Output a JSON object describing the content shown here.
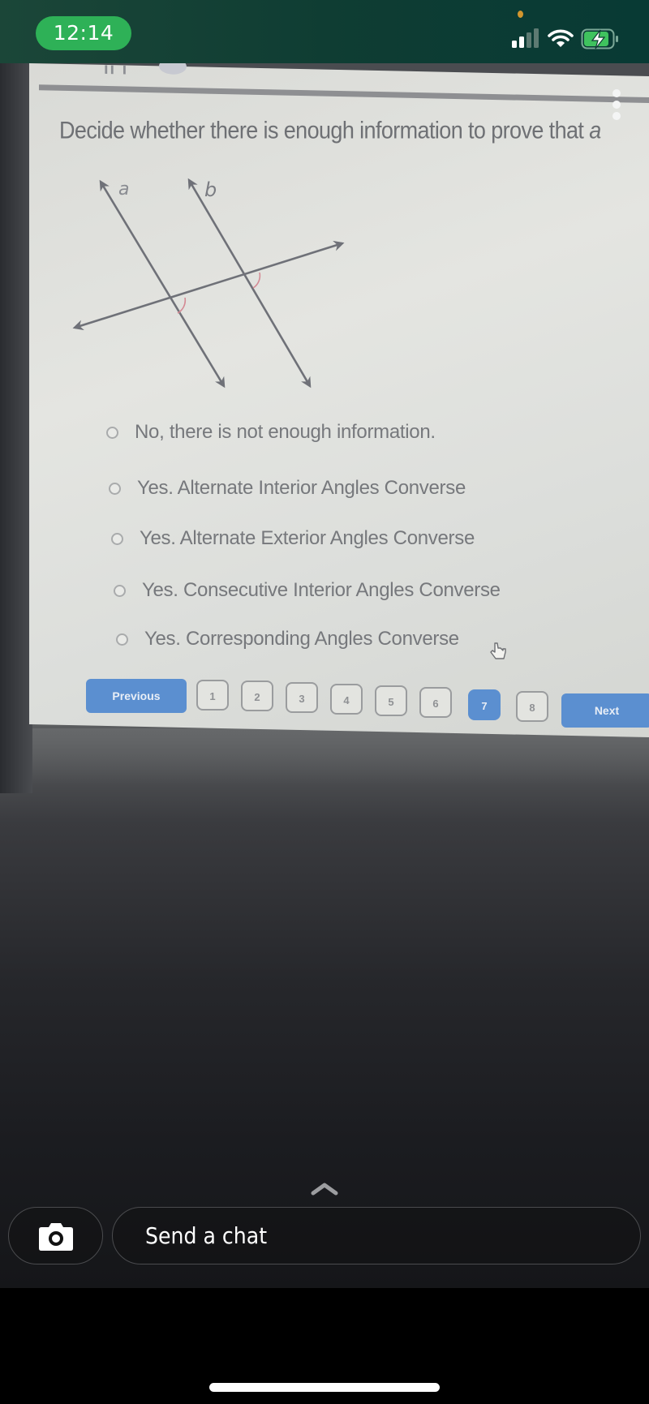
{
  "status_bar": {
    "time": "12:14",
    "icons": [
      "signal-icon",
      "wifi-icon",
      "battery-charging-icon"
    ],
    "time_pill_color": "#2eb157",
    "privacy_dot_color": "#d2962e"
  },
  "quiz": {
    "question": "Decide whether there is enough information to prove that",
    "question_trailing_italic": "a",
    "diagram": {
      "line_labels": [
        "a",
        "b"
      ],
      "description": "Two lines a and b cut by a transversal; two angles are marked with red arcs"
    },
    "options": [
      {
        "label": "No, there is not enough information.",
        "selected": false
      },
      {
        "label": "Yes. Alternate Interior Angles Converse",
        "selected": false
      },
      {
        "label": "Yes. Alternate Exterior Angles Converse",
        "selected": false
      },
      {
        "label": "Yes. Consecutive Interior Angles Converse",
        "selected": false
      },
      {
        "label": "Yes. Corresponding Angles Converse",
        "selected": false
      }
    ],
    "pagination": {
      "previous_label": "Previous",
      "next_label": "Next",
      "pages": [
        "1",
        "2",
        "3",
        "4",
        "5",
        "6",
        "7",
        "8"
      ],
      "current_page": "7"
    },
    "accent_color": "#5b8fd0"
  },
  "chat_bar": {
    "placeholder": "Send a chat",
    "icons": [
      "camera-icon",
      "chevron-up-icon"
    ]
  }
}
